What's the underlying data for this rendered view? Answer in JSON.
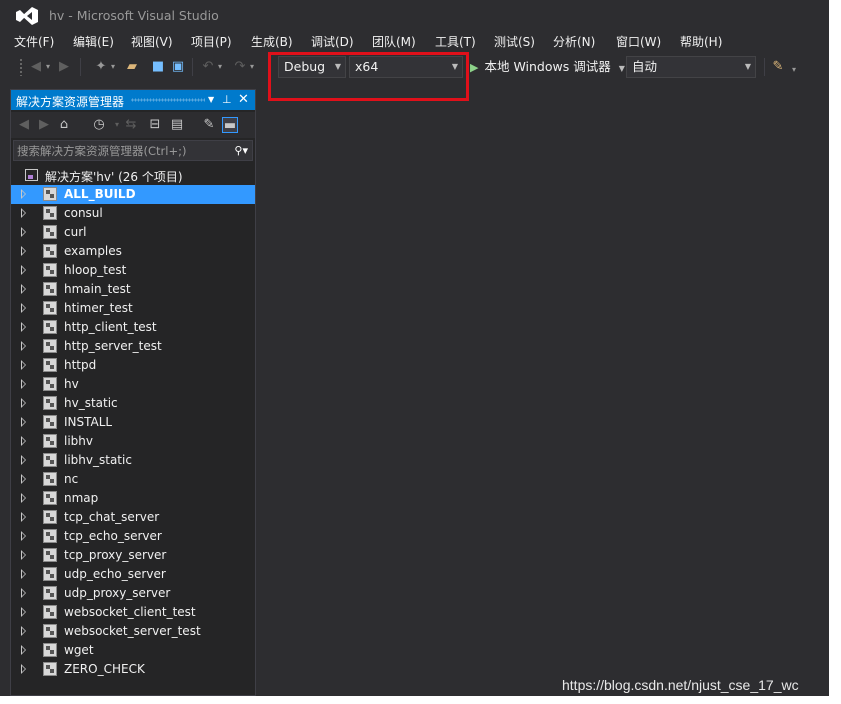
{
  "window": {
    "title": "hv - Microsoft Visual Studio",
    "logo_icon": "visual-studio-logo",
    "accent_color": "#007acc",
    "background_color": "#2d2d30"
  },
  "menu": [
    {
      "label": "文件(F)"
    },
    {
      "label": "编辑(E)"
    },
    {
      "label": "视图(V)"
    },
    {
      "label": "项目(P)"
    },
    {
      "label": "生成(B)"
    },
    {
      "label": "调试(D)"
    },
    {
      "label": "团队(M)"
    },
    {
      "label": "工具(T)"
    },
    {
      "label": "测试(S)"
    },
    {
      "label": "分析(N)"
    },
    {
      "label": "窗口(W)"
    },
    {
      "label": "帮助(H)"
    }
  ],
  "toolbar": {
    "configuration": "Debug",
    "platform": "x64",
    "debug_target": "本地 Windows 调试器",
    "debug_mode": "自动",
    "highlight_color": "#e0101a"
  },
  "explorer": {
    "title": "解决方案资源管理器",
    "search_placeholder": "搜索解决方案资源管理器(Ctrl+;)",
    "solution_label": "解决方案'hv' (26 个项目)",
    "selected_color": "#3399ff",
    "projects": [
      {
        "name": "ALL_BUILD",
        "selected": true
      },
      {
        "name": "consul"
      },
      {
        "name": "curl"
      },
      {
        "name": "examples"
      },
      {
        "name": "hloop_test"
      },
      {
        "name": "hmain_test"
      },
      {
        "name": "htimer_test"
      },
      {
        "name": "http_client_test"
      },
      {
        "name": "http_server_test"
      },
      {
        "name": "httpd"
      },
      {
        "name": "hv"
      },
      {
        "name": "hv_static"
      },
      {
        "name": "INSTALL"
      },
      {
        "name": "libhv"
      },
      {
        "name": "libhv_static"
      },
      {
        "name": "nc"
      },
      {
        "name": "nmap"
      },
      {
        "name": "tcp_chat_server"
      },
      {
        "name": "tcp_echo_server"
      },
      {
        "name": "tcp_proxy_server"
      },
      {
        "name": "udp_echo_server"
      },
      {
        "name": "udp_proxy_server"
      },
      {
        "name": "websocket_client_test"
      },
      {
        "name": "websocket_server_test"
      },
      {
        "name": "wget"
      },
      {
        "name": "ZERO_CHECK"
      }
    ]
  },
  "watermark": "https://blog.csdn.net/njust_cse_17_wc"
}
